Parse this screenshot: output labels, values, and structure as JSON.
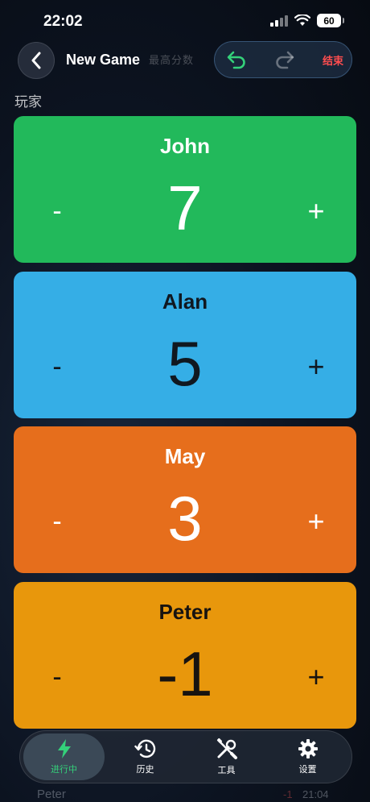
{
  "status_bar": {
    "time": "22:02",
    "battery": "60"
  },
  "header": {
    "title": "New Game",
    "faded_text": "最高分数",
    "end_label": "结束"
  },
  "section_label": "玩家",
  "players": [
    {
      "name": "John",
      "score": "7",
      "minus": "-",
      "plus": "+",
      "color": "#22b95b",
      "text_color": "#ffffff"
    },
    {
      "name": "Alan",
      "score": "5",
      "minus": "-",
      "plus": "+",
      "color": "#35aee6",
      "text_color": "#101820"
    },
    {
      "name": "May",
      "score": "3",
      "minus": "-",
      "plus": "+",
      "color": "#e66e1c",
      "text_color": "#ffffff"
    },
    {
      "name": "Peter",
      "score": "-1",
      "minus": "-",
      "plus": "+",
      "color": "#e8970c",
      "text_color": "#171310"
    }
  ],
  "history_peek": {
    "name": "Peter",
    "delta": "-1",
    "time": "21:04"
  },
  "tabs": [
    {
      "label": "进行中",
      "icon": "bolt-icon",
      "active": true
    },
    {
      "label": "历史",
      "icon": "history-icon",
      "active": false
    },
    {
      "label": "工具",
      "icon": "tools-icon",
      "active": false
    },
    {
      "label": "设置",
      "icon": "gear-icon",
      "active": false
    }
  ],
  "colors": {
    "accent_green": "#34d17a",
    "danger_red": "#ff4d4f"
  }
}
